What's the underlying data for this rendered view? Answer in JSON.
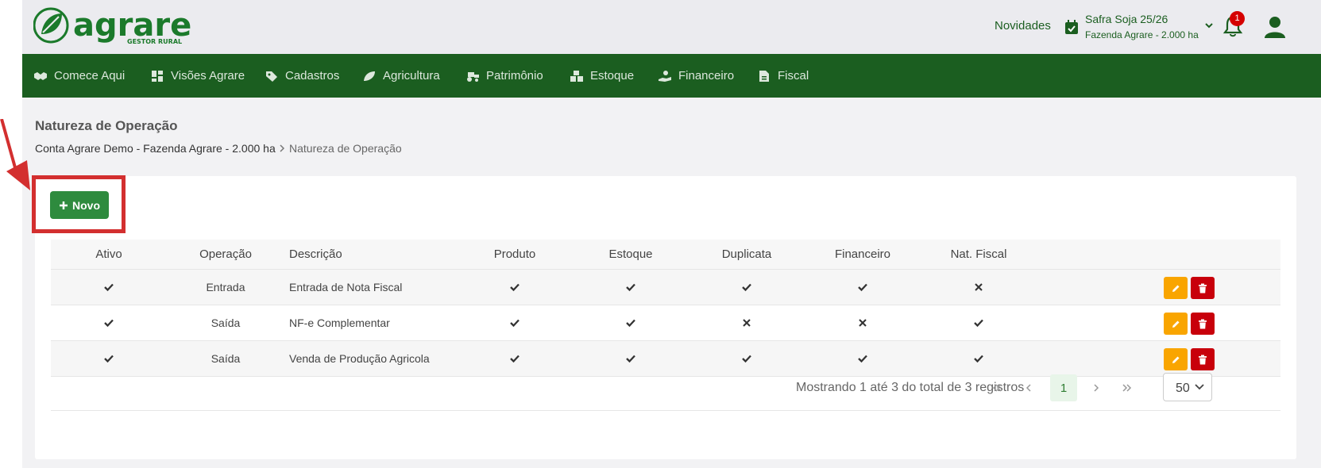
{
  "header": {
    "logo_text": "agrare",
    "logo_subtitle": "GESTOR RURAL",
    "novidades": "Novidades",
    "safra_name": "Safra Soja 25/26",
    "safra_farm": "Fazenda Agrare - 2.000 ha",
    "notifications_count": "1",
    "brand_color": "#1b5e20"
  },
  "nav": {
    "items": [
      {
        "label": "Comece Aqui",
        "icon": "handshake-icon"
      },
      {
        "label": "Visões Agrare",
        "icon": "dashboard-icon"
      },
      {
        "label": "Cadastros",
        "icon": "tag-icon"
      },
      {
        "label": "Agricultura",
        "icon": "leaf-icon"
      },
      {
        "label": "Patrimônio",
        "icon": "tractor-icon"
      },
      {
        "label": "Estoque",
        "icon": "boxes-icon"
      },
      {
        "label": "Financeiro",
        "icon": "hand-money-icon"
      },
      {
        "label": "Fiscal",
        "icon": "invoice-icon"
      }
    ]
  },
  "page": {
    "title": "Natureza de Operação",
    "breadcrumb_root": "Conta Agrare Demo - Fazenda Agrare - 2.000 ha",
    "breadcrumb_current": "Natureza de Operação"
  },
  "toolbar": {
    "new_label": "Novo",
    "accent_color": "#2e8b3e"
  },
  "table": {
    "headers": [
      "Ativo",
      "Operação",
      "Descrição",
      "Produto",
      "Estoque",
      "Duplicata",
      "Financeiro",
      "Nat. Fiscal"
    ],
    "rows": [
      {
        "ativo": true,
        "operacao": "Entrada",
        "descricao": "Entrada de Nota Fiscal",
        "produto": true,
        "estoque": true,
        "duplicata": true,
        "financeiro": true,
        "nat_fiscal": false
      },
      {
        "ativo": true,
        "operacao": "Saída",
        "descricao": "NF-e Complementar",
        "produto": true,
        "estoque": true,
        "duplicata": false,
        "financeiro": false,
        "nat_fiscal": true
      },
      {
        "ativo": true,
        "operacao": "Saída",
        "descricao": "Venda de Produção Agricola",
        "produto": true,
        "estoque": true,
        "duplicata": true,
        "financeiro": true,
        "nat_fiscal": true
      }
    ]
  },
  "pagination": {
    "info": "Mostrando 1 até 3 do total de 3 registros",
    "current_page": "1",
    "page_size": "50"
  }
}
